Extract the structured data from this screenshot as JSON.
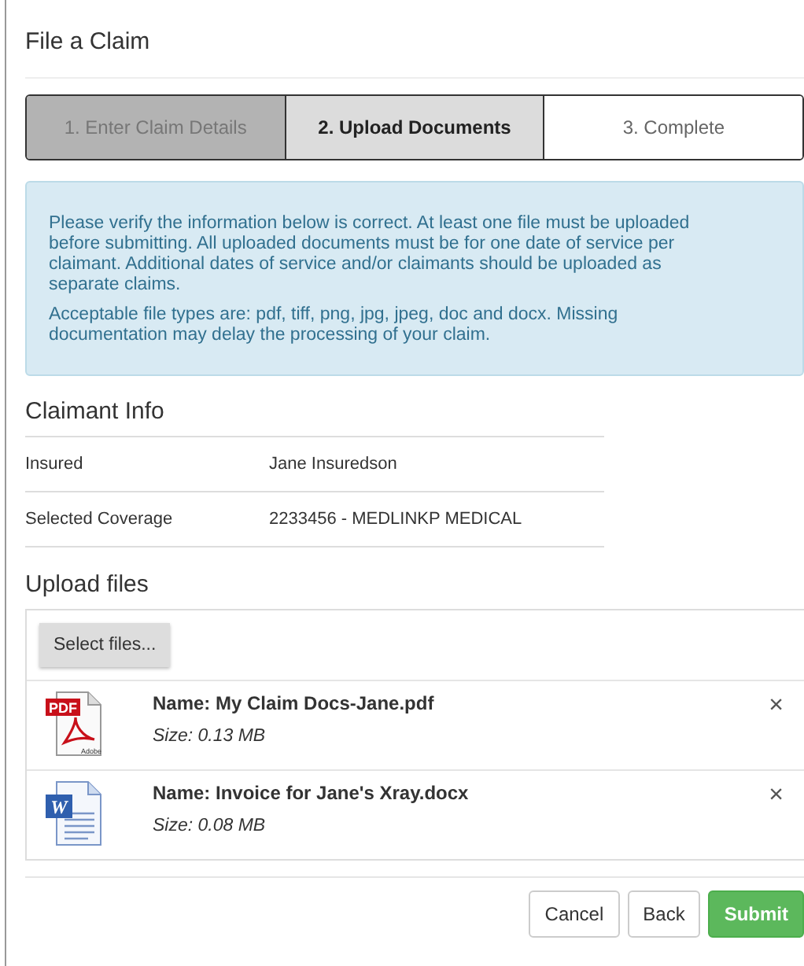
{
  "title": "File a Claim",
  "steps": [
    {
      "label": "1. Enter Claim Details",
      "completed": true,
      "selected": false
    },
    {
      "label": "2. Upload Documents",
      "completed": false,
      "selected": true
    },
    {
      "label": "3. Complete",
      "completed": false,
      "selected": false
    }
  ],
  "alert": {
    "paragraphs": [
      "Please verify the information below is correct. At least one file must be uploaded before submitting. All uploaded documents must be for one date of service per claimant. Additional dates of service and/or claimants should be uploaded as separate claims.",
      "Acceptable file types are: pdf, tiff, png, jpg, jpeg, doc and docx. Missing documentation may delay the processing of your claim."
    ]
  },
  "claimant_info": {
    "heading": "Claimant Info",
    "rows": [
      {
        "label": "Insured",
        "value": "Jane Insuredson"
      },
      {
        "label": "Selected Coverage",
        "value": "2233456 - MEDLINKP MEDICAL"
      }
    ]
  },
  "upload": {
    "heading": "Upload files",
    "select_button": "Select files...",
    "files": [
      {
        "kind": "pdf",
        "icon_label": "PDF",
        "icon_caption": "Adobe",
        "name": "Name: My Claim Docs-Jane.pdf",
        "size": "Size: 0.13 MB",
        "remove": "×"
      },
      {
        "kind": "word",
        "icon_label": "W",
        "name": "Name: Invoice for Jane's Xray.docx",
        "size": "Size: 0.08 MB",
        "remove": "×"
      }
    ]
  },
  "buttons": [
    {
      "label": "Cancel",
      "kind": "default"
    },
    {
      "label": "Back",
      "kind": "default"
    },
    {
      "label": "Submit",
      "kind": "primary"
    }
  ]
}
